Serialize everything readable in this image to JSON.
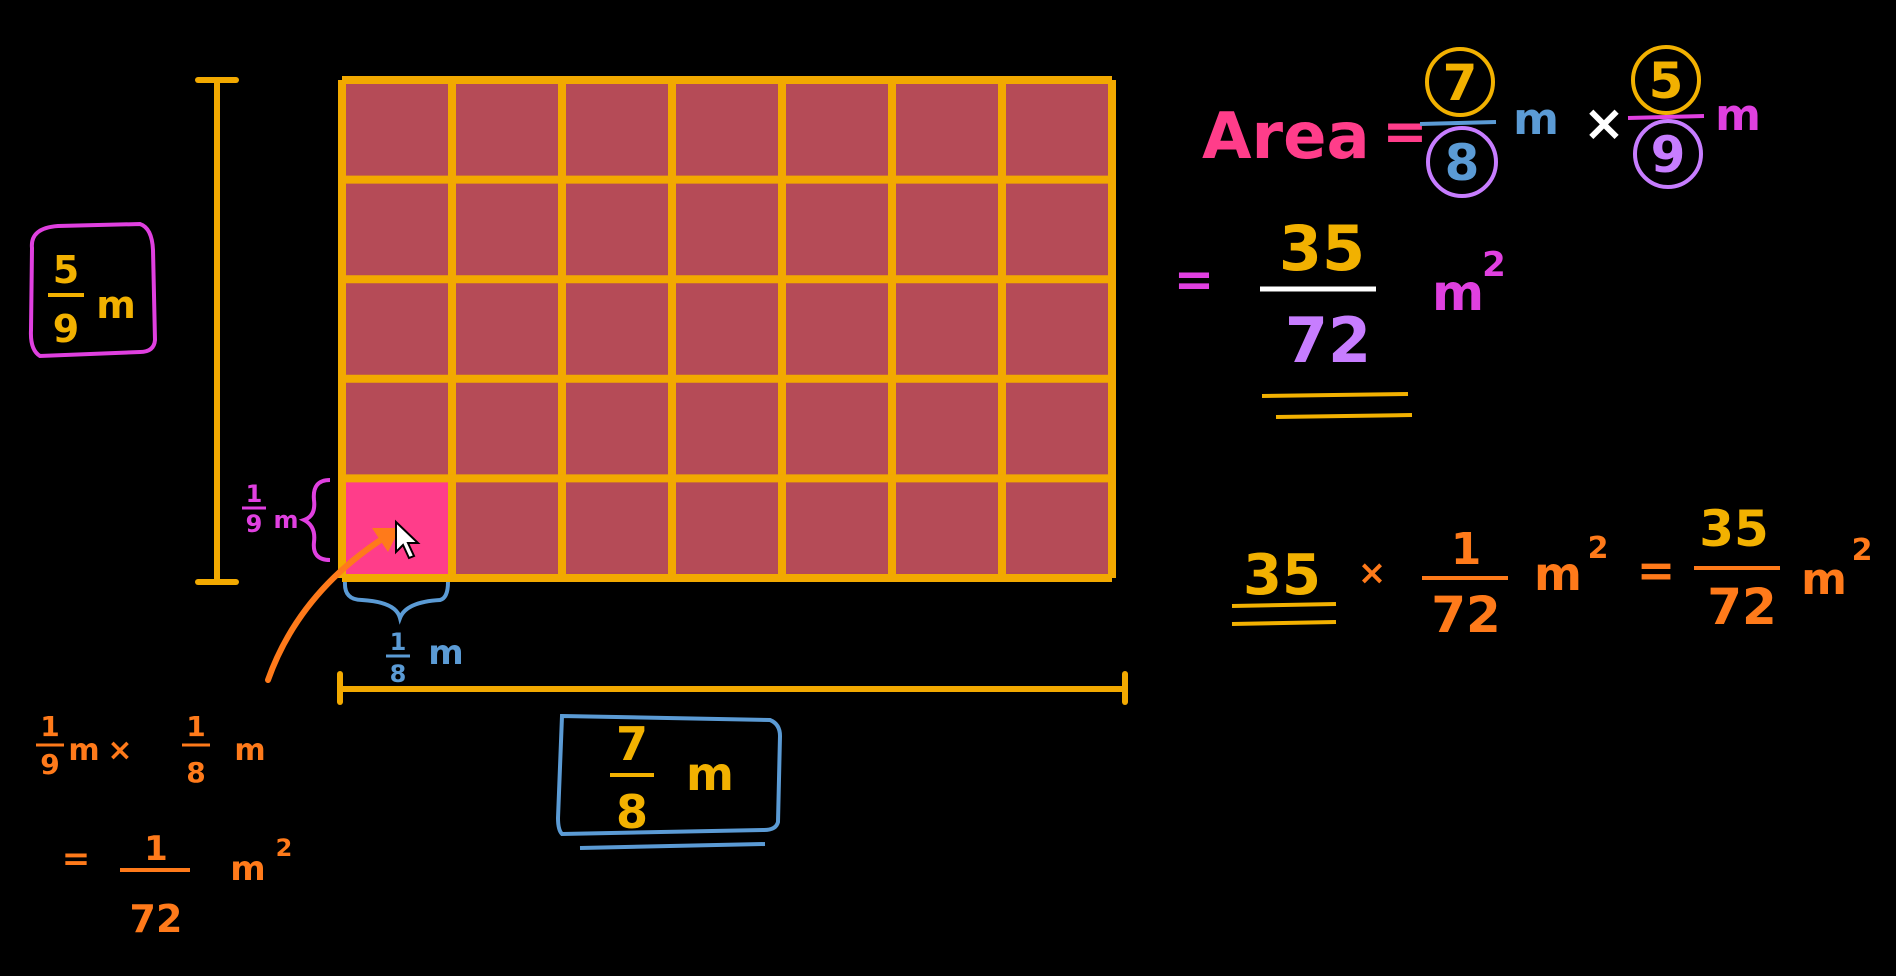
{
  "colors": {
    "background": "#000000",
    "grid_line": "#f2a900",
    "cell_fill": "#b54b57",
    "highlight_cell": "#ff3d8a",
    "pink": "#ff3d8a",
    "magenta": "#e040e0",
    "violet": "#c77dff",
    "blue": "#5b9bd5",
    "orange": "#ff7a1a",
    "gold": "#f2b100",
    "white": "#ffffff"
  },
  "grid": {
    "columns": 7,
    "rows": 5
  },
  "height_label": {
    "num": "5",
    "den": "9",
    "unit": "m"
  },
  "width_label": {
    "num": "7",
    "den": "8",
    "unit": "m"
  },
  "unit_height_label": {
    "num": "1",
    "den": "9",
    "unit": "m"
  },
  "unit_width_label": {
    "num": "1",
    "den": "8",
    "unit": "m"
  },
  "unit_area": {
    "a_num": "1",
    "a_den": "9",
    "a_unit": "m",
    "times": "×",
    "b_num": "1",
    "b_den": "8",
    "b_unit": "m",
    "equals": "=",
    "r_num": "1",
    "r_den": "72",
    "r_unit": "m",
    "r_exp": "2"
  },
  "area_formula": {
    "label": "Area",
    "equals": "=",
    "a_num": "7",
    "a_den": "8",
    "a_unit": "m",
    "times": "×",
    "b_num": "5",
    "b_den": "9",
    "b_unit": "m"
  },
  "area_result": {
    "equals": "=",
    "num": "35",
    "den": "72",
    "unit": "m",
    "exp": "2"
  },
  "count_formula": {
    "count": "35",
    "times": "×",
    "f_num": "1",
    "f_den": "72",
    "f_unit": "m",
    "f_exp": "2",
    "equals": "=",
    "r_num": "35",
    "r_den": "72",
    "r_unit": "m",
    "r_exp": "2"
  }
}
